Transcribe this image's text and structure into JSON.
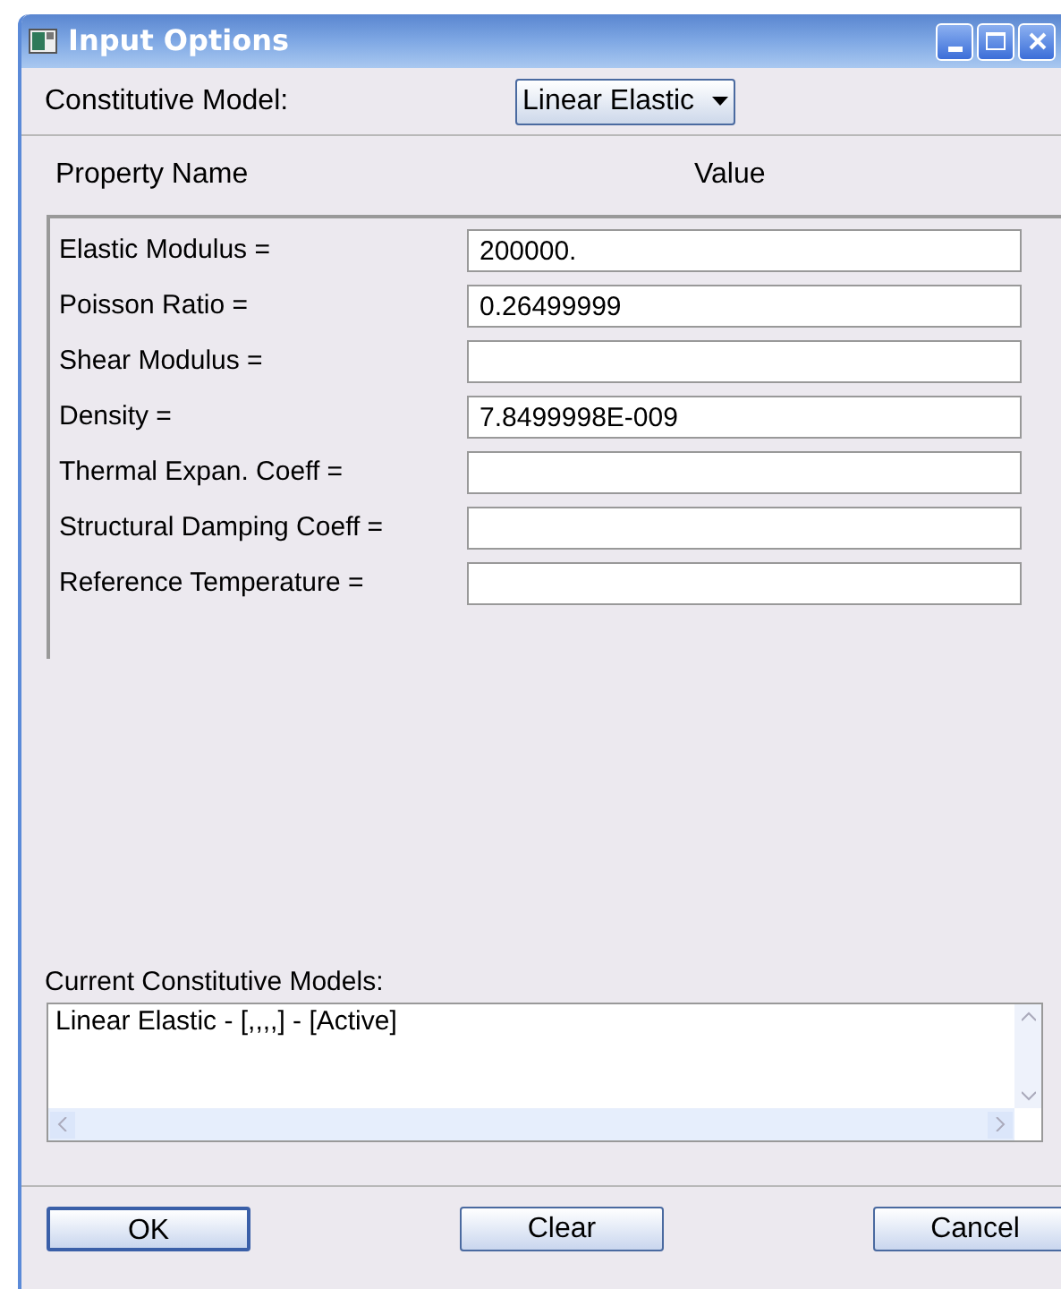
{
  "window": {
    "title": "Input Options"
  },
  "constitutive_model": {
    "label": "Constitutive Model:",
    "value": "Linear Elastic"
  },
  "properties": {
    "columns": [
      "Property Name",
      "Value"
    ],
    "rows": [
      {
        "name": "Elastic Modulus =",
        "value": "200000."
      },
      {
        "name": "Poisson Ratio =",
        "value": "0.26499999"
      },
      {
        "name": "Shear Modulus ="
      },
      {
        "name": "Density =",
        "value": "7.8499998E-009"
      },
      {
        "name": "Thermal Expan. Coeff ="
      },
      {
        "name": "Structural Damping Coeff ="
      },
      {
        "name": "Reference Temperature ="
      }
    ]
  },
  "current_models": {
    "label": "Current Constitutive Models:",
    "items": [
      "Linear Elastic - [,,,,] - [Active]"
    ]
  },
  "buttons": [
    {
      "label": "OK",
      "default": true
    },
    {
      "label": "Clear",
      "default": false
    },
    {
      "label": "Cancel",
      "default": false
    }
  ]
}
